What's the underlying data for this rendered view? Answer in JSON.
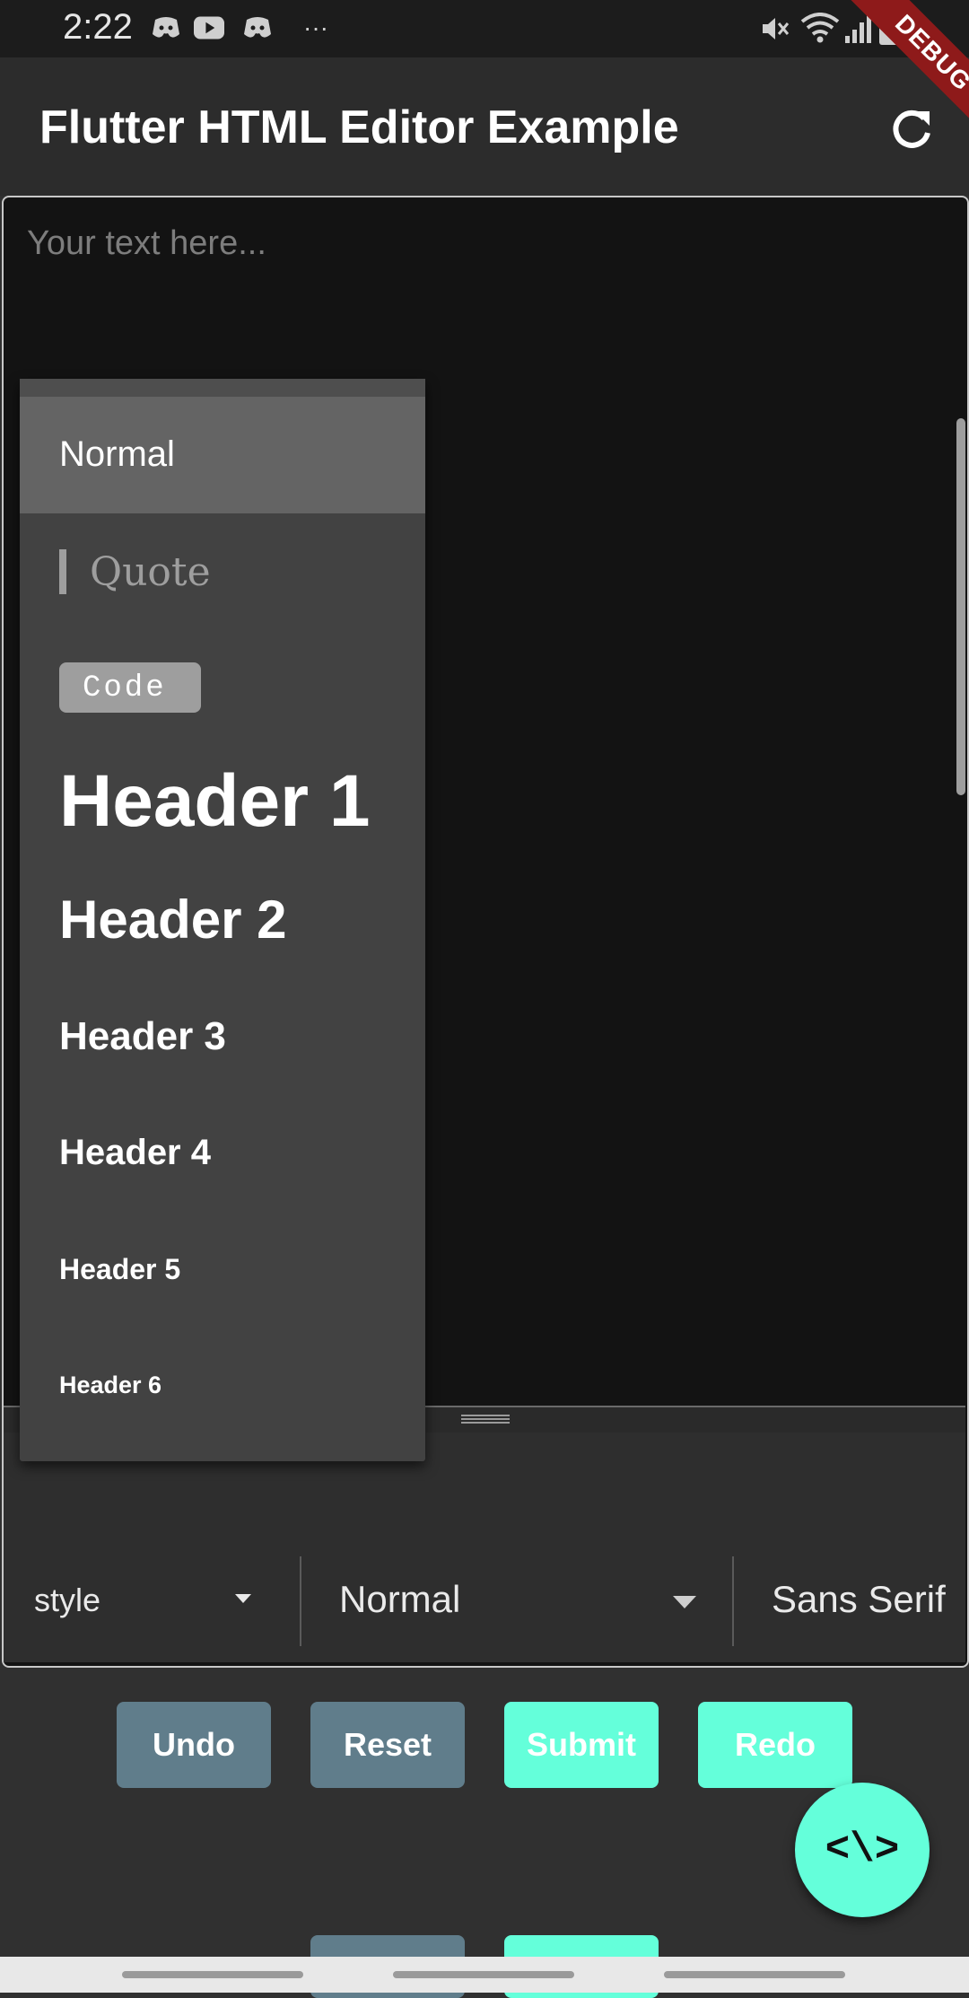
{
  "status_bar": {
    "time": "2:22",
    "icons_left": [
      "discord-icon",
      "youtube-icon",
      "discord-icon",
      "more-icon"
    ],
    "icons_right": [
      "mute-icon",
      "wifi-icon",
      "signal-icon",
      "battery-icon"
    ],
    "more": "···"
  },
  "debug_banner": "DEBUG",
  "app_bar": {
    "title": "Flutter HTML Editor Example",
    "action_icon": "refresh-icon"
  },
  "editor": {
    "placeholder": "Your text here..."
  },
  "style_dropdown": {
    "items": [
      "Normal",
      "Quote",
      "Code",
      "Header 1",
      "Header 2",
      "Header 3",
      "Header 4",
      "Header 5",
      "Header 6"
    ],
    "selected": "Normal"
  },
  "toolbar": {
    "style_label": "style",
    "paragraph_value": "Normal",
    "font_value": "Sans Serif"
  },
  "buttons": {
    "undo": "Undo",
    "reset": "Reset",
    "submit": "Submit",
    "redo": "Redo"
  },
  "fab": {
    "label": "<\\>"
  },
  "colors": {
    "accent": "#64ffda",
    "secondary_button": "#607d8b",
    "background": "#303030",
    "editor_background": "#131313",
    "dropdown_background": "#424242"
  }
}
